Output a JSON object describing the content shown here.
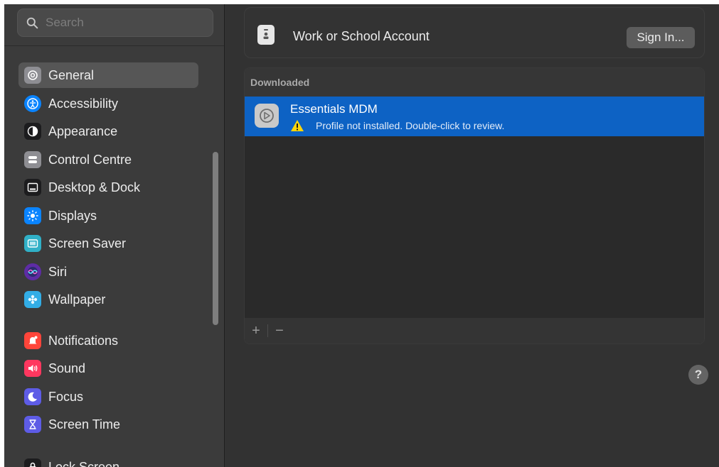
{
  "search": {
    "placeholder": "Search"
  },
  "sidebar": {
    "items": [
      {
        "label": "General",
        "icon": "gear-icon",
        "color": "#8e8e93",
        "selected": true
      },
      {
        "label": "Accessibility",
        "icon": "accessibility-icon",
        "color": "#0a84ff"
      },
      {
        "label": "Appearance",
        "icon": "appearance-icon",
        "color": "#1c1c1e"
      },
      {
        "label": "Control Centre",
        "icon": "control-centre-icon",
        "color": "#8e8e93"
      },
      {
        "label": "Desktop & Dock",
        "icon": "desktop-dock-icon",
        "color": "#1c1c1e"
      },
      {
        "label": "Displays",
        "icon": "displays-icon",
        "color": "#0a84ff"
      },
      {
        "label": "Screen Saver",
        "icon": "screen-saver-icon",
        "color": "#30b0c7"
      },
      {
        "label": "Siri",
        "icon": "siri-icon",
        "color": "#5e2ca5"
      },
      {
        "label": "Wallpaper",
        "icon": "wallpaper-icon",
        "color": "#32ade6"
      },
      {
        "label": "Notifications",
        "icon": "notifications-icon",
        "color": "#ff453a"
      },
      {
        "label": "Sound",
        "icon": "sound-icon",
        "color": "#ff375f"
      },
      {
        "label": "Focus",
        "icon": "focus-icon",
        "color": "#5e5ce6"
      },
      {
        "label": "Screen Time",
        "icon": "screen-time-icon",
        "color": "#5e5ce6"
      },
      {
        "label": "Lock Screen",
        "icon": "lock-icon",
        "color": "#1c1c1e"
      }
    ]
  },
  "account": {
    "title": "Work or School Account",
    "sign_in": "Sign In..."
  },
  "profiles": {
    "header": "Downloaded",
    "items": [
      {
        "name": "Essentials MDM",
        "status": "Profile not installed. Double-click to review."
      }
    ],
    "add": "+",
    "remove": "−"
  },
  "help": "?"
}
